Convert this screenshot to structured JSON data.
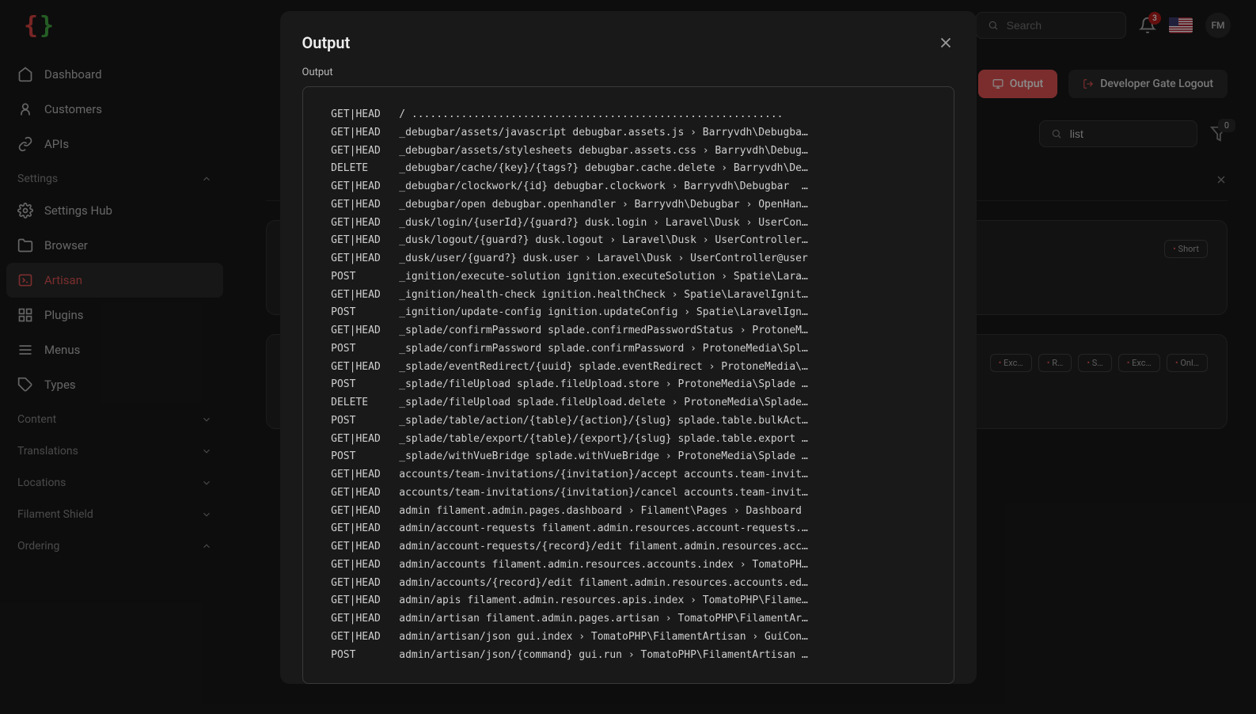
{
  "topbar": {
    "search_placeholder": "Search",
    "notification_count": "3",
    "avatar_initials": "FM"
  },
  "sidebar": {
    "items": [
      {
        "label": "Dashboard"
      },
      {
        "label": "Customers"
      },
      {
        "label": "APIs"
      }
    ],
    "settings_group": "Settings",
    "settings_items": [
      {
        "label": "Settings Hub"
      },
      {
        "label": "Browser"
      },
      {
        "label": "Artisan"
      },
      {
        "label": "Plugins"
      },
      {
        "label": "Menus"
      },
      {
        "label": "Types"
      }
    ],
    "groups": [
      "Content",
      "Translations",
      "Locations",
      "Filament Shield",
      "Ordering"
    ]
  },
  "page": {
    "output_btn": "Output",
    "logout_btn": "Developer Gate Logout",
    "filter_value": "list",
    "filter_count": "0",
    "card1_tags": [
      "Short"
    ],
    "card2_tags": [
      "Exc…",
      "R…",
      "S…",
      "Exc…",
      "Onl…"
    ]
  },
  "modal": {
    "title": "Output",
    "field_label": "Output",
    "lines": [
      "GET|HEAD   / ............................................................",
      "GET|HEAD   _debugbar/assets/javascript debugbar.assets.js › Barryvdh\\Debugba…",
      "GET|HEAD   _debugbar/assets/stylesheets debugbar.assets.css › Barryvdh\\Debug…",
      "DELETE     _debugbar/cache/{key}/{tags?} debugbar.cache.delete › Barryvdh\\De…",
      "GET|HEAD   _debugbar/clockwork/{id} debugbar.clockwork › Barryvdh\\Debugbar  …",
      "GET|HEAD   _debugbar/open debugbar.openhandler › Barryvdh\\Debugbar › OpenHan…",
      "GET|HEAD   _dusk/login/{userId}/{guard?} dusk.login › Laravel\\Dusk › UserCon…",
      "GET|HEAD   _dusk/logout/{guard?} dusk.logout › Laravel\\Dusk › UserController…",
      "GET|HEAD   _dusk/user/{guard?} dusk.user › Laravel\\Dusk › UserController@user",
      "POST       _ignition/execute-solution ignition.executeSolution › Spatie\\Lara…",
      "GET|HEAD   _ignition/health-check ignition.healthCheck › Spatie\\LaravelIgnit…",
      "POST       _ignition/update-config ignition.updateConfig › Spatie\\LaravelIgn…",
      "GET|HEAD   _splade/confirmPassword splade.confirmedPasswordStatus › ProtoneM…",
      "POST       _splade/confirmPassword splade.confirmPassword › ProtoneMedia\\Spl…",
      "GET|HEAD   _splade/eventRedirect/{uuid} splade.eventRedirect › ProtoneMedia\\…",
      "POST       _splade/fileUpload splade.fileUpload.store › ProtoneMedia\\Splade …",
      "DELETE     _splade/fileUpload splade.fileUpload.delete › ProtoneMedia\\Splade…",
      "POST       _splade/table/action/{table}/{action}/{slug} splade.table.bulkAct…",
      "GET|HEAD   _splade/table/export/{table}/{export}/{slug} splade.table.export …",
      "POST       _splade/withVueBridge splade.withVueBridge › ProtoneMedia\\Splade …",
      "GET|HEAD   accounts/team-invitations/{invitation}/accept accounts.team-invit…",
      "GET|HEAD   accounts/team-invitations/{invitation}/cancel accounts.team-invit…",
      "GET|HEAD   admin filament.admin.pages.dashboard › Filament\\Pages › Dashboard",
      "GET|HEAD   admin/account-requests filament.admin.resources.account-requests.…",
      "GET|HEAD   admin/account-requests/{record}/edit filament.admin.resources.acc…",
      "GET|HEAD   admin/accounts filament.admin.resources.accounts.index › TomatoPH…",
      "GET|HEAD   admin/accounts/{record}/edit filament.admin.resources.accounts.ed…",
      "GET|HEAD   admin/apis filament.admin.resources.apis.index › TomatoPHP\\Filame…",
      "GET|HEAD   admin/artisan filament.admin.pages.artisan › TomatoPHP\\FilamentAr…",
      "GET|HEAD   admin/artisan/json gui.index › TomatoPHP\\FilamentArtisan › GuiCon…",
      "POST       admin/artisan/json/{command} gui.run › TomatoPHP\\FilamentArtisan …"
    ]
  }
}
